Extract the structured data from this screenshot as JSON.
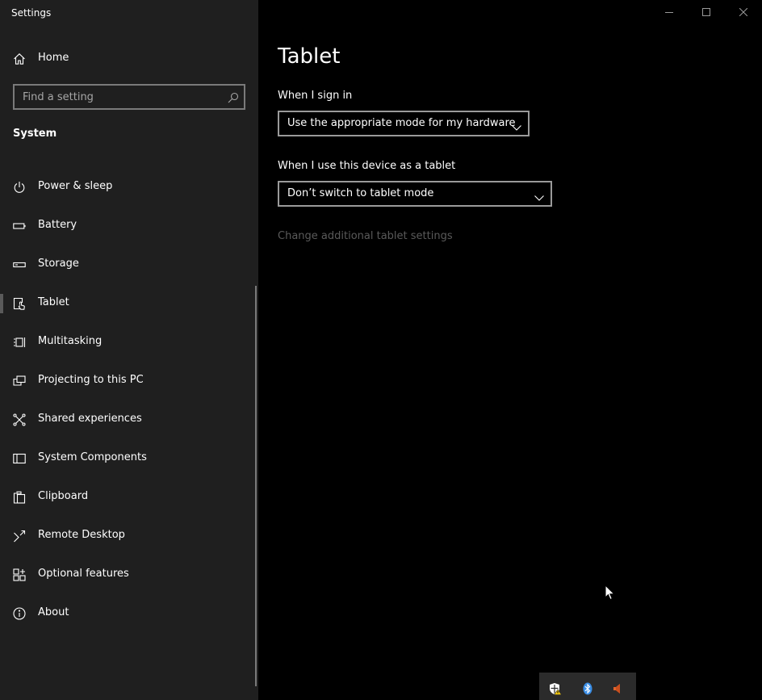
{
  "window": {
    "title": "Settings"
  },
  "sidebar": {
    "home_label": "Home",
    "search_placeholder": "Find a setting",
    "section_title": "System",
    "items": [
      {
        "label": "Power & sleep",
        "icon": "power-icon"
      },
      {
        "label": "Battery",
        "icon": "battery-icon"
      },
      {
        "label": "Storage",
        "icon": "storage-icon"
      },
      {
        "label": "Tablet",
        "icon": "tablet-icon",
        "selected": true
      },
      {
        "label": "Multitasking",
        "icon": "multitasking-icon"
      },
      {
        "label": "Projecting to this PC",
        "icon": "projecting-icon"
      },
      {
        "label": "Shared experiences",
        "icon": "shared-experiences-icon"
      },
      {
        "label": "System Components",
        "icon": "system-components-icon"
      },
      {
        "label": "Clipboard",
        "icon": "clipboard-icon"
      },
      {
        "label": "Remote Desktop",
        "icon": "remote-desktop-icon"
      },
      {
        "label": "Optional features",
        "icon": "optional-features-icon"
      },
      {
        "label": "About",
        "icon": "about-icon"
      }
    ]
  },
  "main": {
    "title": "Tablet",
    "sign_in": {
      "label": "When I sign in",
      "value": "Use the appropriate mode for my hardware"
    },
    "tablet_use": {
      "label": "When I use this device as a tablet",
      "value": "Don’t switch to tablet mode"
    },
    "additional_link": "Change additional tablet settings"
  },
  "tray": {
    "icons": [
      "security-warning-icon",
      "bluetooth-icon",
      "volume-muted-icon"
    ]
  },
  "colors": {
    "sidebar_bg": "#1f1f1f",
    "main_bg": "#000000",
    "disabled_text": "#5a5a5a",
    "bluetooth": "#3a8ee6",
    "volume_muted": "#e0632d"
  }
}
